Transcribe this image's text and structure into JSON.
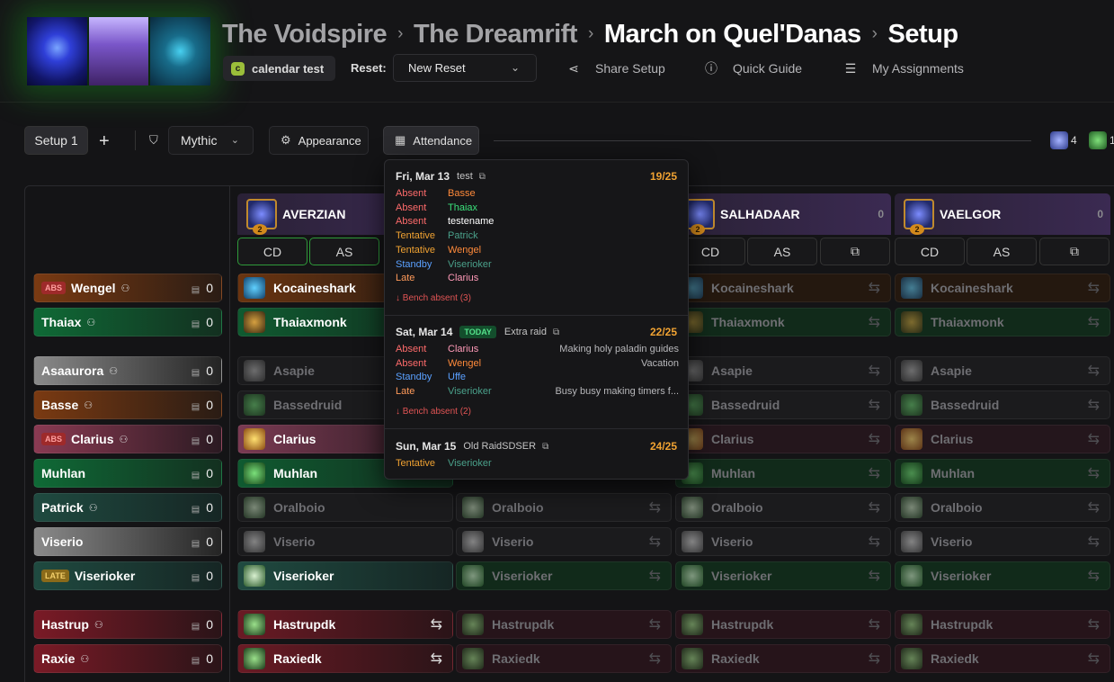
{
  "breadcrumb": [
    "The Voidspire",
    "The Dreamrift",
    "March on Quel'Danas",
    "Setup"
  ],
  "calendar_tag": {
    "letter": "c",
    "label": "calendar test"
  },
  "reset": {
    "label": "Reset:",
    "value": "New Reset"
  },
  "header_links": {
    "share": "Share Setup",
    "guide": "Quick Guide",
    "assignments": "My Assignments"
  },
  "toolbar": {
    "setup_tab": "Setup 1",
    "add": "+",
    "difficulty": "Mythic",
    "appearance": "Appearance",
    "attendance": "Attendance"
  },
  "mini_counts": [
    "4",
    "1"
  ],
  "bosses": [
    {
      "name": "AVERZIAN",
      "badge": "2",
      "count": "0"
    },
    {
      "name": "SALHADAAR",
      "badge": "2",
      "count": "0"
    },
    {
      "name": "VAELGOR",
      "badge": "2",
      "count": "0"
    }
  ],
  "buttons": {
    "cd": "CD",
    "as": "AS"
  },
  "players": [
    {
      "name": "Wengel",
      "tag": "ABS",
      "count": "0"
    },
    {
      "name": "Thaiax",
      "tag": "",
      "count": "0"
    },
    {
      "name": "Asaaurora",
      "tag": "",
      "count": "0"
    },
    {
      "name": "Basse",
      "tag": "",
      "count": "0"
    },
    {
      "name": "Clarius",
      "tag": "ABS",
      "count": "0"
    },
    {
      "name": "Muhlan",
      "tag": "",
      "count": "0"
    },
    {
      "name": "Patrick",
      "tag": "",
      "count": "0"
    },
    {
      "name": "Viserio",
      "tag": "",
      "count": "0"
    },
    {
      "name": "Viserioker",
      "tag": "LATE",
      "count": "0"
    },
    {
      "name": "Hastrup",
      "tag": "",
      "count": "0"
    },
    {
      "name": "Raxie",
      "tag": "",
      "count": "0"
    }
  ],
  "characters": [
    "Kocaineshark",
    "Thaiaxmonk",
    "Asapie",
    "Bassedruid",
    "Clarius",
    "Muhlan",
    "Oralboio",
    "Viserio",
    "Viserioker",
    "Hastrupdk",
    "Raxiedk"
  ],
  "attendance": [
    {
      "date": "Fri, Mar 13",
      "name": "test",
      "today": "",
      "fraction": "19/25",
      "rows": [
        {
          "status": "Absent",
          "player": "Basse",
          "note": ""
        },
        {
          "status": "Absent",
          "player": "Thaiax",
          "note": ""
        },
        {
          "status": "Absent",
          "player": "testename",
          "note": ""
        },
        {
          "status": "Tentative",
          "player": "Patrick",
          "note": ""
        },
        {
          "status": "Tentative",
          "player": "Wengel",
          "note": ""
        },
        {
          "status": "Standby",
          "player": "Viserioker",
          "note": ""
        },
        {
          "status": "Late",
          "player": "Clarius",
          "note": ""
        }
      ],
      "bench": "Bench absent (3)"
    },
    {
      "date": "Sat, Mar 14",
      "name": "Extra raid",
      "today": "TODAY",
      "fraction": "22/25",
      "rows": [
        {
          "status": "Absent",
          "player": "Clarius",
          "note": "Making holy paladin guides"
        },
        {
          "status": "Absent",
          "player": "Wengel",
          "note": "Vacation"
        },
        {
          "status": "Standby",
          "player": "Uffe",
          "note": ""
        },
        {
          "status": "Late",
          "player": "Viserioker",
          "note": "Busy busy making timers f..."
        }
      ],
      "bench": "Bench absent (2)"
    },
    {
      "date": "Sun, Mar 15",
      "name": "Old RaidSDSER",
      "today": "",
      "fraction": "24/25",
      "rows": [
        {
          "status": "Tentative",
          "player": "Viserioker",
          "note": ""
        }
      ],
      "bench": ""
    }
  ],
  "colors": {
    "accent_green": "#2f9a3a",
    "absent": "#ff6b6b",
    "tentative": "#f0a232",
    "standby": "#5aa0ff",
    "late": "#ff9a5a",
    "fraction": "#f0a232"
  }
}
